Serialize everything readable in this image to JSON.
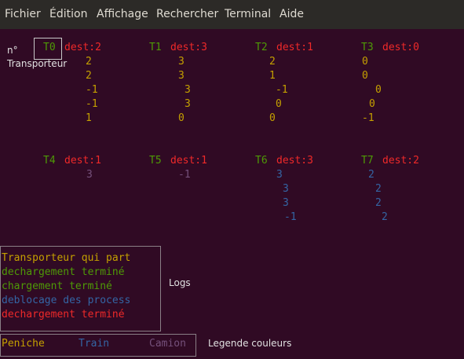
{
  "menu": [
    "Fichier",
    "Édition",
    "Affichage",
    "Rechercher",
    "Terminal",
    "Aide"
  ],
  "header": {
    "num_label": "n°",
    "transporteur_label": "Transporteur"
  },
  "top_row": [
    {
      "id": "T0",
      "dest": "dest:2",
      "values": [
        "2",
        "2",
        "-1",
        "-1",
        "1"
      ]
    },
    {
      "id": "T1",
      "dest": "dest:3",
      "values": [
        "3",
        "3",
        "3",
        "3",
        "0"
      ]
    },
    {
      "id": "T2",
      "dest": "dest:1",
      "values": [
        "2",
        "1",
        "-1",
        "0",
        "0"
      ]
    },
    {
      "id": "T3",
      "dest": "dest:0",
      "values": [
        "0",
        "0",
        "0",
        "0",
        "-1"
      ]
    }
  ],
  "bottom_row": [
    {
      "id": "T4",
      "dest": "dest:1",
      "values": [
        "3"
      ]
    },
    {
      "id": "T5",
      "dest": "dest:1",
      "values": [
        "-1"
      ]
    },
    {
      "id": "T6",
      "dest": "dest:3",
      "values": [
        "3",
        "3",
        "3",
        "-1"
      ]
    },
    {
      "id": "T7",
      "dest": "dest:2",
      "values": [
        "2",
        "2",
        "2",
        "2"
      ]
    }
  ],
  "logs": {
    "title": "Logs",
    "lines": [
      {
        "text": "Transporteur qui part",
        "color": "#c4a000"
      },
      {
        "text": "dechargement terminé",
        "color": "#4e9a06"
      },
      {
        "text": "chargement terminé",
        "color": "#4e9a06"
      },
      {
        "text": "deblocage des process",
        "color": "#3465a4"
      },
      {
        "text": "dechargement terminé",
        "color": "#ef2929"
      }
    ]
  },
  "legend": {
    "title": "Legende couleurs",
    "items": [
      {
        "text": "Peniche",
        "color": "#c4a000"
      },
      {
        "text": "Train",
        "color": "#3465a4"
      },
      {
        "text": "Camion",
        "color": "#75507b"
      }
    ]
  }
}
